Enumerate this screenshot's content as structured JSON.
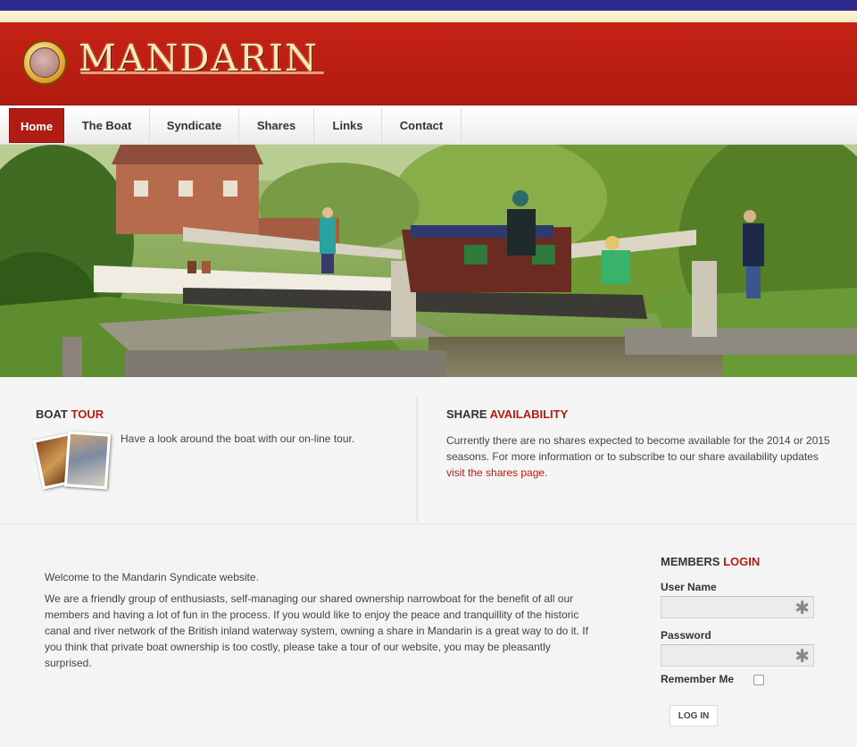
{
  "site": {
    "name": "MANDARIN"
  },
  "nav": {
    "items": [
      "Home",
      "The Boat",
      "Syndicate",
      "Shares",
      "Links",
      "Contact"
    ],
    "active": "Home"
  },
  "boat_tour": {
    "heading_main": "BOAT",
    "heading_accent": "TOUR",
    "text": "Have a look around the boat with our on-line tour."
  },
  "share_availability": {
    "heading_main": "SHARE",
    "heading_accent": "AVAILABILITY",
    "text": "Currently there are no shares expected to become available for the 2014 or 2015 seasons. For more information or to subscribe to our share availability updates",
    "link": "visit the shares page",
    "trailing": "."
  },
  "intro": {
    "welcome": "Welcome to the Mandarin Syndicate website.",
    "body": "We are a friendly group of enthusiasts, self-managing our shared ownership narrowboat for the benefit of all our members and having a lot of fun in the process. If you would like to enjoy the peace and tranquillity of the historic canal and river network of the British inland waterway system, owning a share in Mandarin is a great way to do it. If you think that private boat ownership is too costly, please take a tour of our website, you may be pleasantly surprised."
  },
  "login": {
    "heading_main": "MEMBERS",
    "heading_accent": "LOGIN",
    "username_label": "User Name",
    "password_label": "Password",
    "required_mark": "✱",
    "remember_label": "Remember Me",
    "button": "LOG IN"
  },
  "colors": {
    "brand_red": "#b11d12",
    "top_bar": "#2e2a8c"
  }
}
